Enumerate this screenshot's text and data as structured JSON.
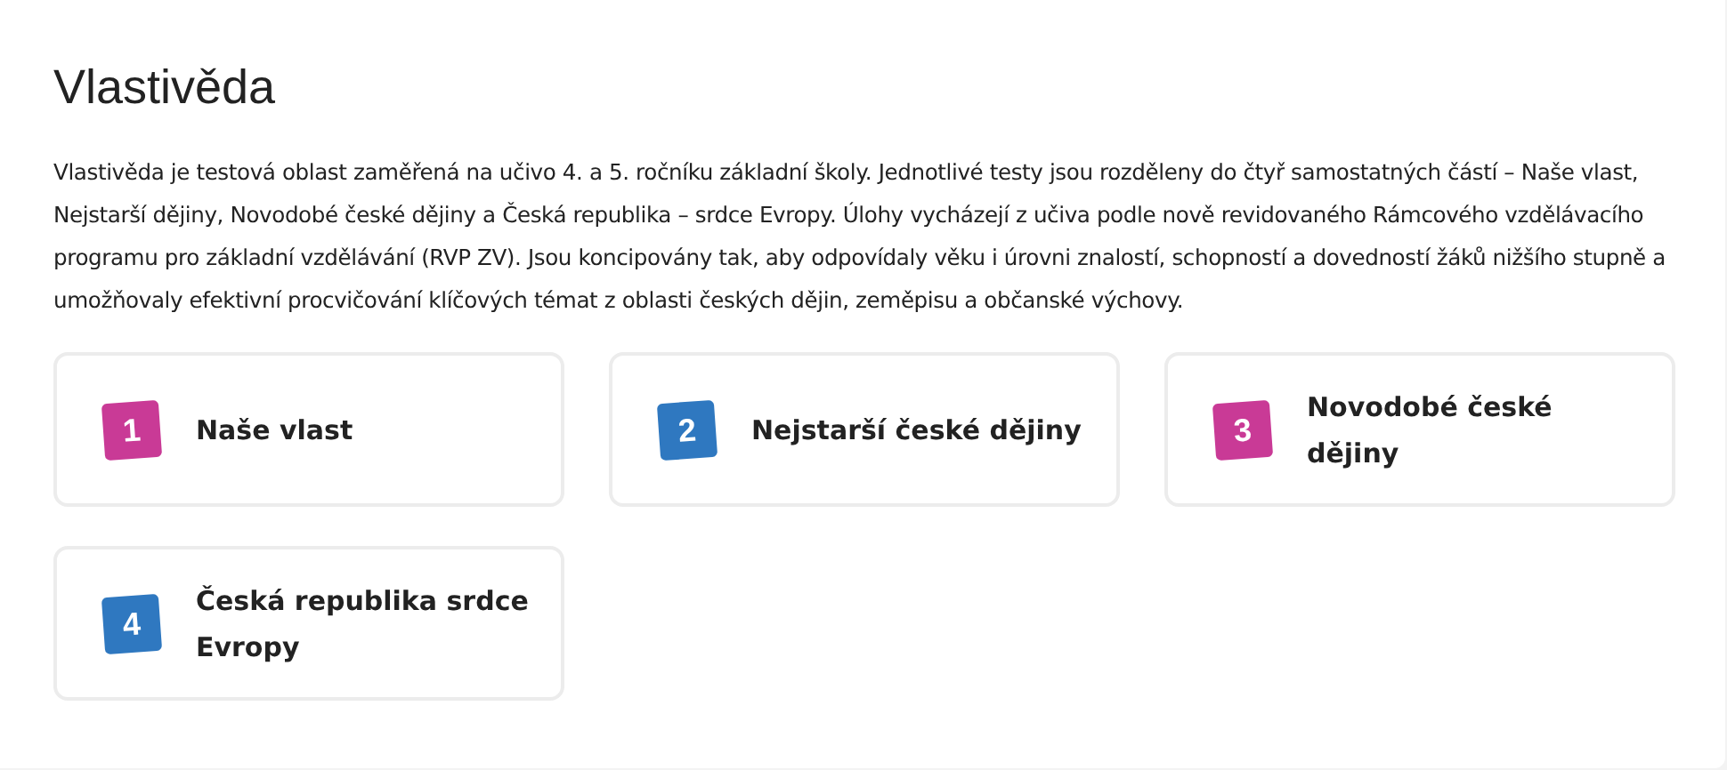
{
  "title": "Vlastivěda",
  "description": "Vlastivěda je testová oblast zaměřená na učivo 4. a 5. ročníku základní školy. Jednotlivé testy jsou rozděleny do čtyř samostatných částí – Naše vlast, Nejstarší dějiny, Novodobé české dějiny a Česká republika – srdce Evropy. Úlohy vycházejí z učiva podle nově revidovaného Rámcového vzdělávacího programu pro základní vzdělávání (RVP ZV). Jsou koncipovány tak, aby odpovídaly věku i úrovni znalostí, schopností a dovedností žáků nižšího stupně a umožňovaly efektivní procvičování klíčových témat z oblasti českých dějin, zeměpisu a občanské výchovy.",
  "topics": [
    {
      "number": "1",
      "label": "Naše vlast",
      "color": "#c93a96"
    },
    {
      "number": "2",
      "label": "Nejstarší české dějiny",
      "color": "#2f78c0"
    },
    {
      "number": "3",
      "label": "Novodobé české dějiny",
      "color": "#c93a96"
    },
    {
      "number": "4",
      "label": "Česká republika srdce Evropy",
      "color": "#2f78c0"
    }
  ]
}
